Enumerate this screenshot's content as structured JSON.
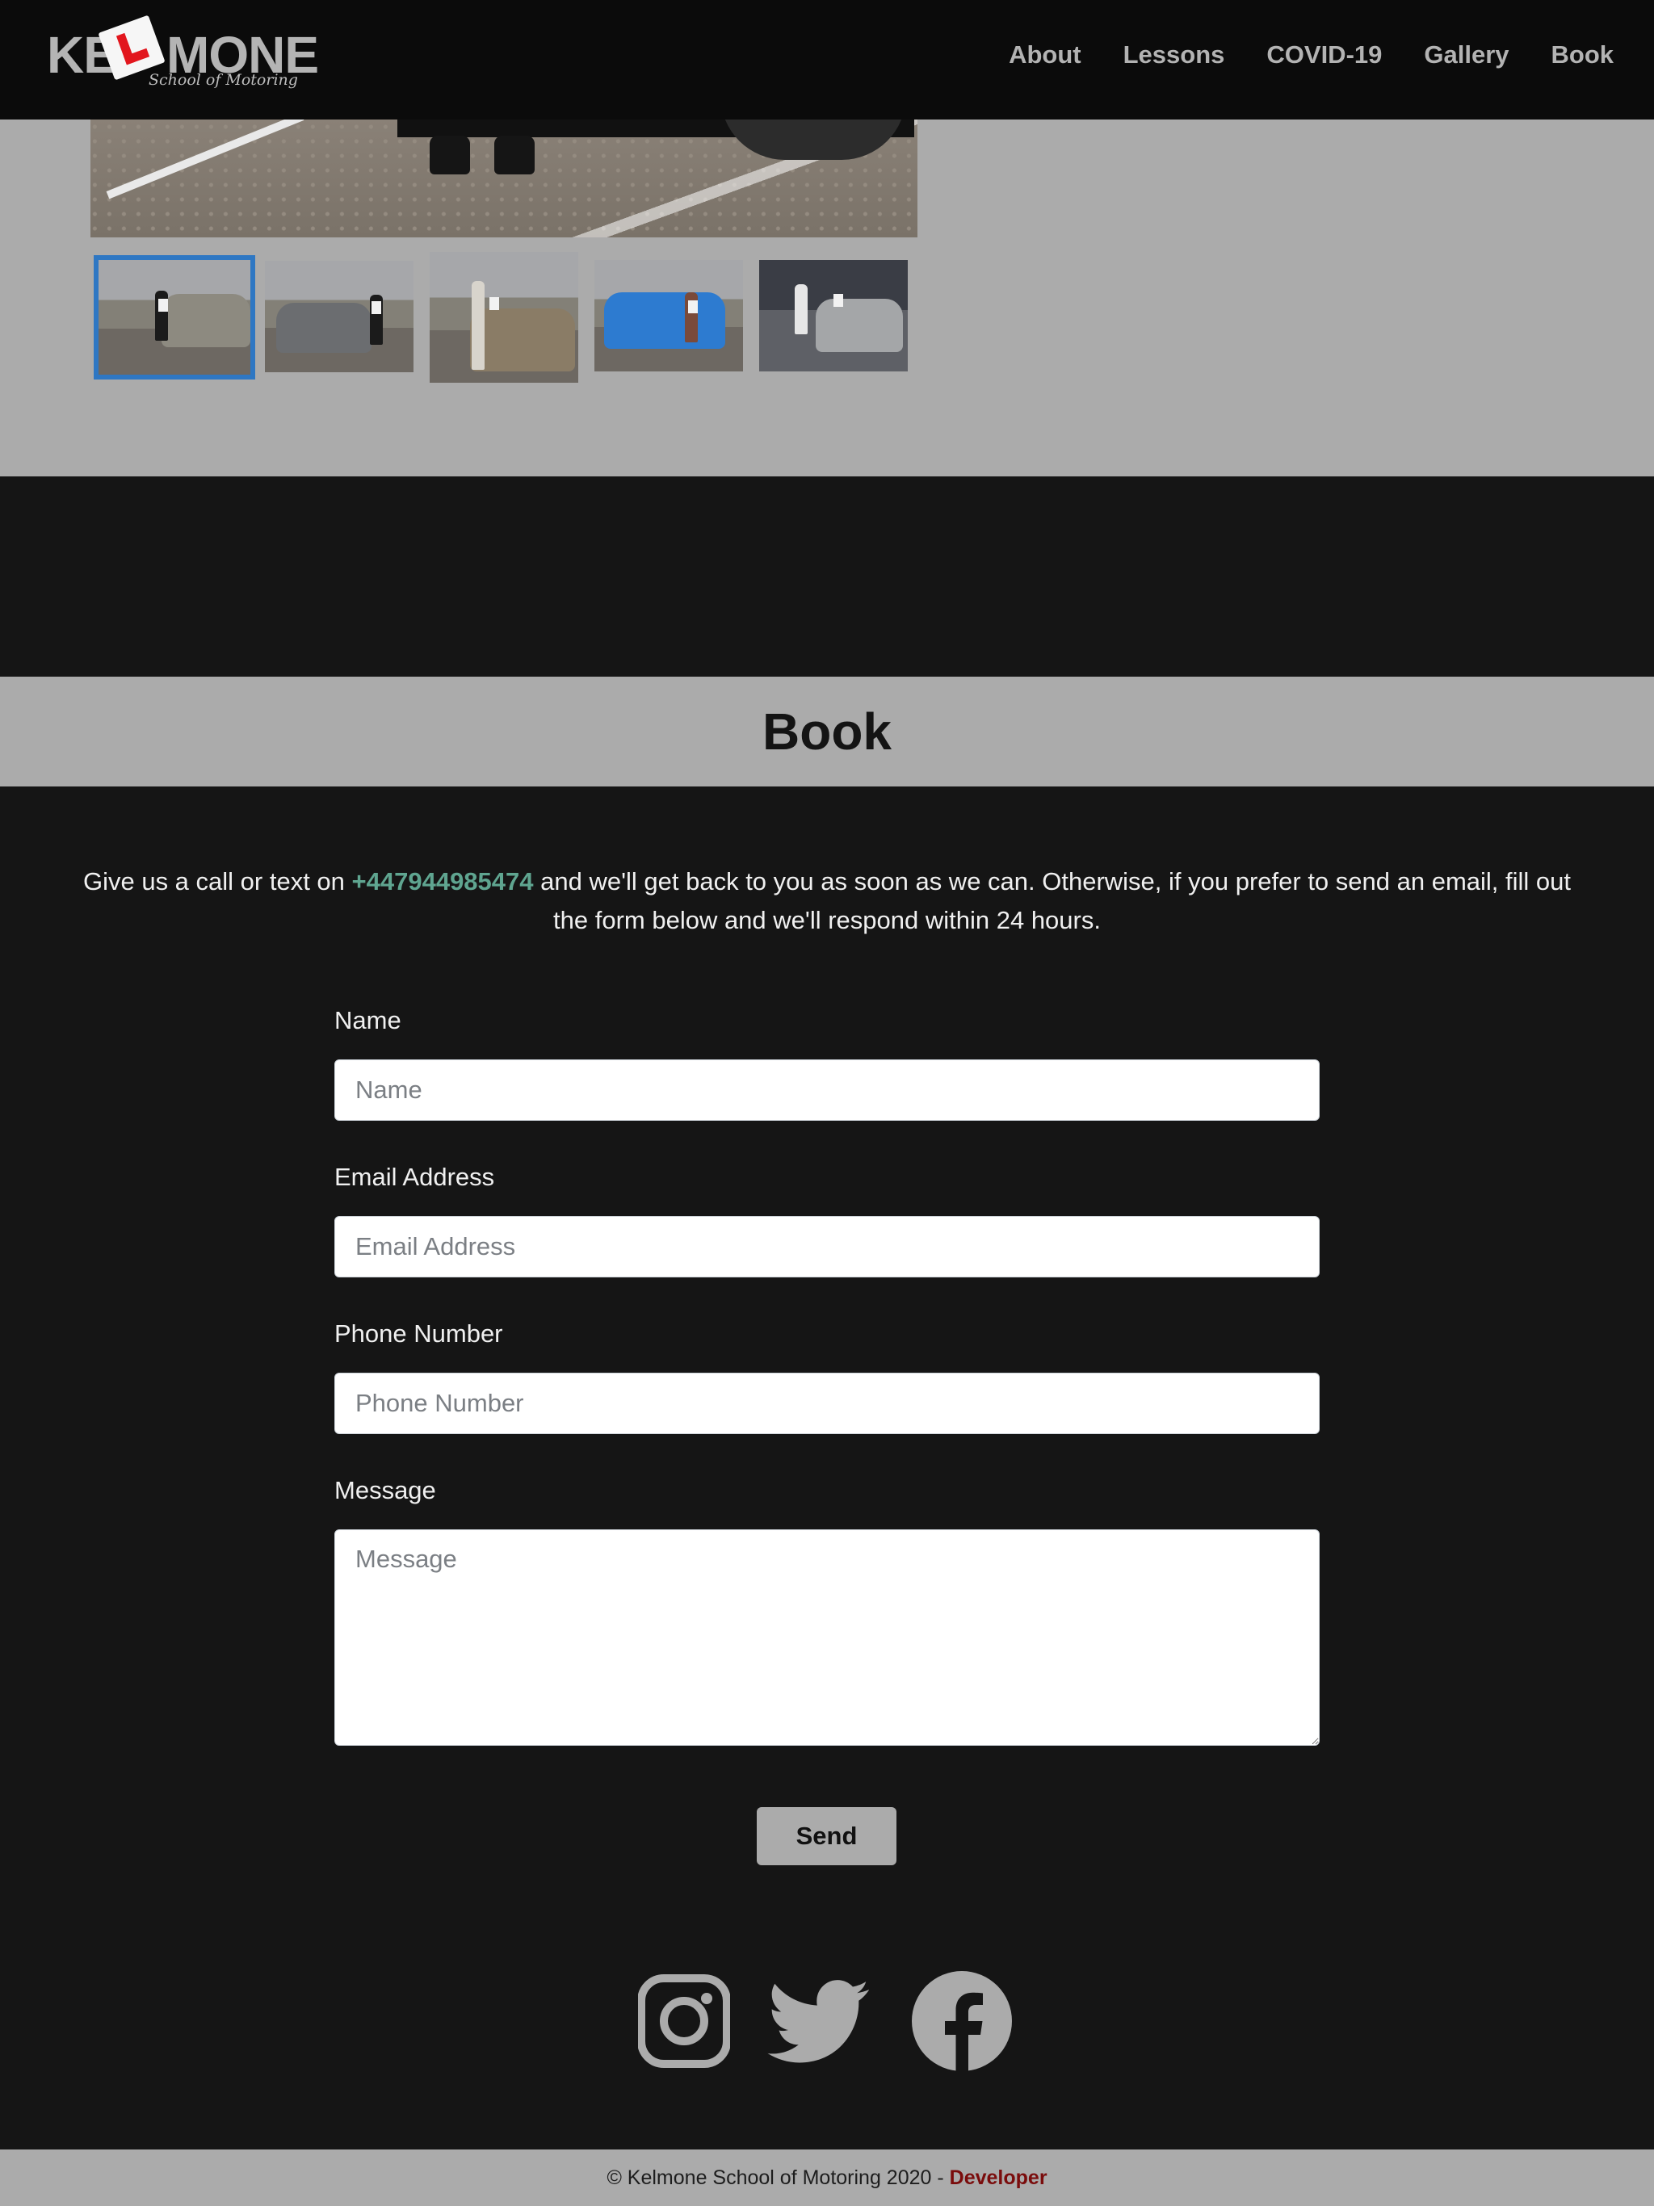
{
  "header": {
    "logo": {
      "word_left": "KE",
      "word_right": "MONE",
      "tagline": "School of Motoring"
    },
    "nav": [
      {
        "label": "About"
      },
      {
        "label": "Lessons"
      },
      {
        "label": "COVID-19"
      },
      {
        "label": "Gallery"
      },
      {
        "label": "Book"
      }
    ]
  },
  "gallery": {
    "selected_thumbnail": 1,
    "thumbnail_count": 5
  },
  "book": {
    "title": "Book",
    "intro_before": "Give us a call or text on ",
    "phone": "+447944985474",
    "intro_after": " and we'll get back to you as soon as we can. Otherwise, if you prefer to send an email, fill out the form below and we'll respond within 24 hours.",
    "form": {
      "name_label": "Name",
      "name_placeholder": "Name",
      "email_label": "Email Address",
      "email_placeholder": "Email Address",
      "phone_label": "Phone Number",
      "phone_placeholder": "Phone Number",
      "message_label": "Message",
      "message_placeholder": "Message",
      "send_label": "Send"
    }
  },
  "social": [
    {
      "icon": "instagram-icon"
    },
    {
      "icon": "twitter-icon"
    },
    {
      "icon": "facebook-icon"
    }
  ],
  "footer": {
    "copyright": "© Kelmone School of Motoring 2020 - ",
    "developer_link": "Developer"
  },
  "colors": {
    "header_bg": "#0b0b0b",
    "section_gray": "#ababab",
    "page_dark": "#151515",
    "phone_accent": "#5fa590",
    "thumb_selected": "#2e77c3",
    "developer_link": "#7a0c0c"
  }
}
